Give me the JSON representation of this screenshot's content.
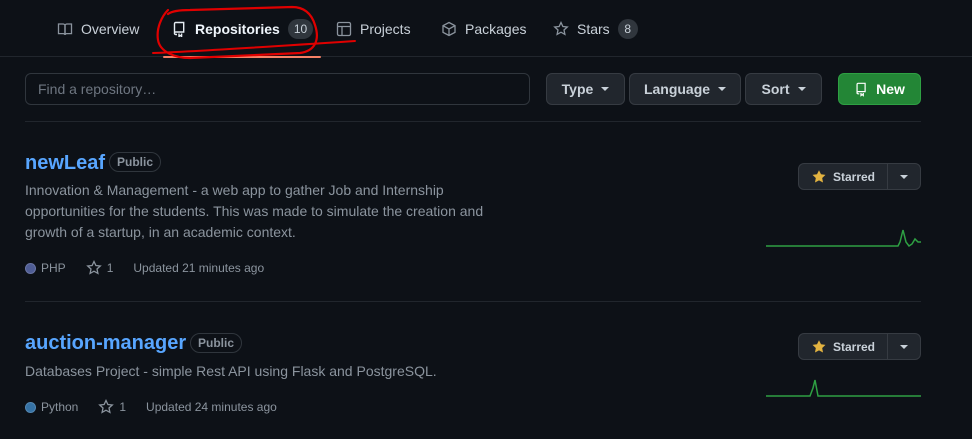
{
  "tabs": [
    {
      "label": "Overview",
      "icon": "book-icon"
    },
    {
      "label": "Repositories",
      "icon": "repo-icon",
      "count": "10",
      "selected": true
    },
    {
      "label": "Projects",
      "icon": "table-icon"
    },
    {
      "label": "Packages",
      "icon": "package-icon"
    },
    {
      "label": "Stars",
      "icon": "star-icon",
      "count": "8"
    }
  ],
  "filters": {
    "search_placeholder": "Find a repository…",
    "type_label": "Type",
    "language_label": "Language",
    "sort_label": "Sort",
    "new_label": "New"
  },
  "repos": [
    {
      "name": "newLeaf",
      "visibility": "Public",
      "description": "Innovation & Management - a web app to gather Job and Internship opportunities for the students. This was made to simulate the creation and growth of a startup, in an academic context.",
      "language": "PHP",
      "language_color": "#4F5D95",
      "stars": "1",
      "updated": "Updated 21 minutes ago",
      "star_button": "Starred"
    },
    {
      "name": "auction-manager",
      "visibility": "Public",
      "description": "Databases Project - simple Rest API using Flask and PostgreSQL.",
      "language": "Python",
      "language_color": "#3572A5",
      "stars": "1",
      "updated": "Updated 24 minutes ago",
      "star_button": "Starred"
    }
  ],
  "colors": {
    "background": "#0d1117",
    "link": "#58a6ff",
    "accent_new": "#238636",
    "annotation": "#e00000",
    "sparkline": "#2ea043"
  }
}
